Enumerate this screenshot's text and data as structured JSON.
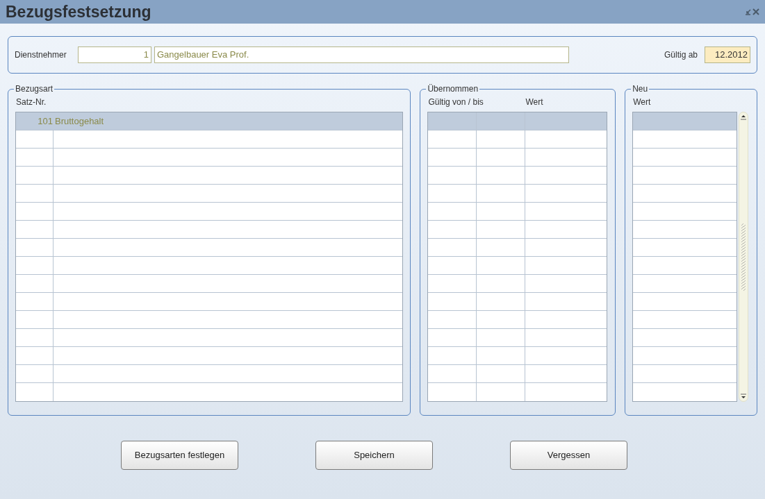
{
  "window": {
    "title": "Bezugsfestsetzung"
  },
  "header": {
    "employee_label": "Dienstnehmer",
    "employee_number": "1",
    "employee_name": "Gangelbauer Eva Prof.",
    "valid_from_label": "Gültig ab",
    "valid_from": "12.2012"
  },
  "bezugsart": {
    "legend": "Bezugsart",
    "column_header": "Satz-Nr.",
    "rows": [
      {
        "satz_nr": "101",
        "name": "Bruttogehalt",
        "selected": true
      }
    ]
  },
  "uebernommen": {
    "legend": "Übernommen",
    "columns": [
      "Gültig von / bis",
      "Wert"
    ],
    "rows": [
      {
        "selected": true
      }
    ]
  },
  "neu": {
    "legend": "Neu",
    "columns": [
      "Wert"
    ],
    "rows": [
      {
        "selected": true
      }
    ]
  },
  "buttons": [
    "Bezugsarten festlegen",
    "Speichern",
    "Vergessen"
  ]
}
